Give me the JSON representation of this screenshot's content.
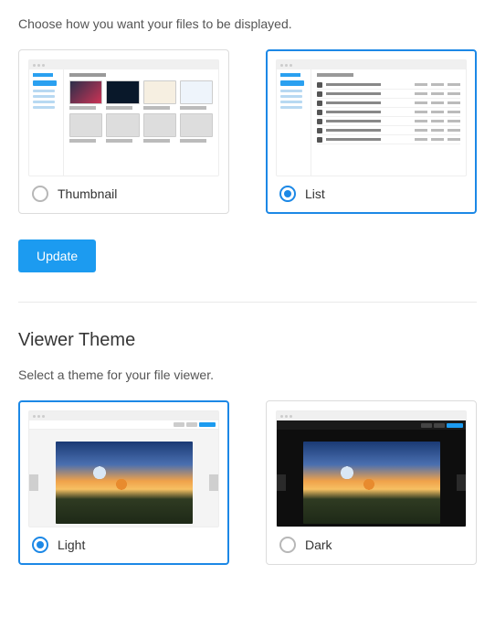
{
  "display": {
    "description": "Choose how you want your files to be displayed.",
    "options": {
      "thumbnail": {
        "label": "Thumbnail",
        "selected": false
      },
      "list": {
        "label": "List",
        "selected": true
      }
    },
    "update_button": "Update"
  },
  "viewer_theme": {
    "title": "Viewer Theme",
    "description": "Select a theme for your file viewer.",
    "options": {
      "light": {
        "label": "Light",
        "selected": true
      },
      "dark": {
        "label": "Dark",
        "selected": false
      }
    }
  }
}
